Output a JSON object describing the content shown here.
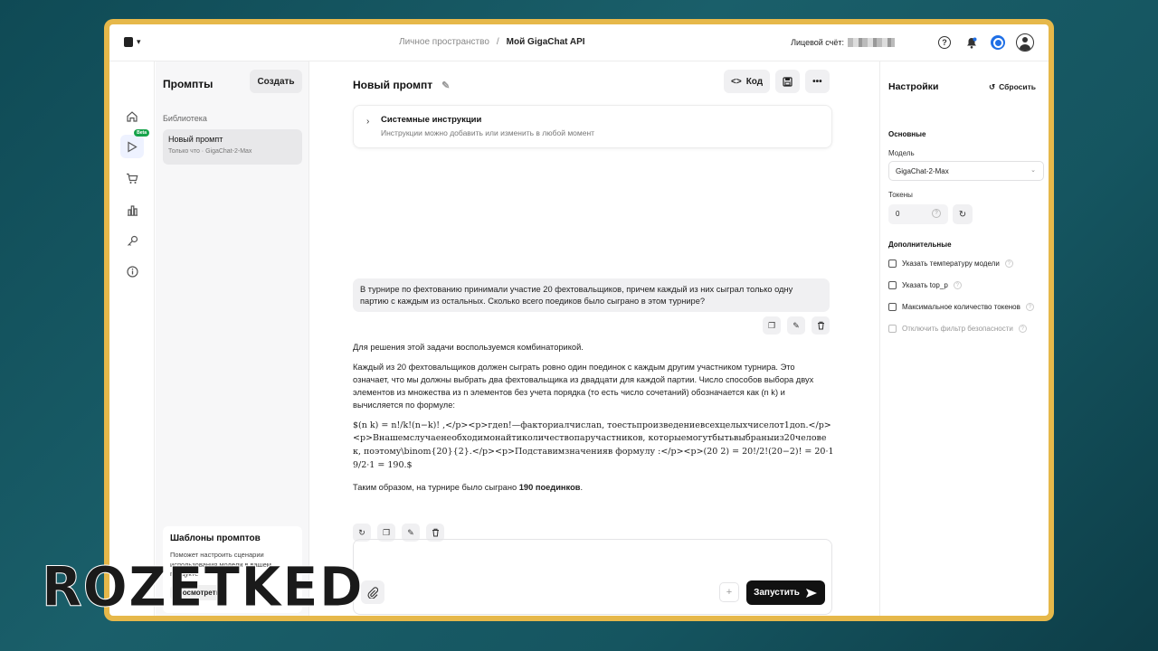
{
  "topbar": {
    "crumb_parent": "Личное пространство",
    "crumb_sep": "/",
    "crumb_current": "Мой GigaChat API",
    "account_label": "Лицевой счёт:"
  },
  "rail": {
    "beta": "Beta"
  },
  "prompts": {
    "title": "Промпты",
    "create": "Создать",
    "library": "Библиотека",
    "item_title": "Новый промпт",
    "item_sub": "Только что · GigaChat-2-Max",
    "templates_title": "Шаблоны промптов",
    "templates_desc": "Поможет настроить сценарии использования модели в вашем продукте",
    "templates_btn": "Посмотреть"
  },
  "main": {
    "title": "Новый промпт",
    "code_btn": "Код",
    "sys_title": "Системные инструкции",
    "sys_desc": "Инструкции можно добавить или изменить в любой момент",
    "user_msg": "В турнире по фехтованию принимали участие 20 фехтовальщиков, причем каждый из них сыграл только одну партию с каждым из остальных. Сколько всего поедиков было сыграно в этом турнире?",
    "ans_p1": "Для решения этой задачи воспользуемся комбинаторикой.",
    "ans_p2": "Каждый из 20 фехтовальщиков должен сыграть ровно один поединок с каждым другим участником турнира. Это означает, что мы должны выбрать два фехтовальщика из двадцати для каждой партии. Число способов выбора двух элементов из множества из n элементов без учета порядка (то есть число сочетаний) обозначается как (n k) и вычисляется по формуле:",
    "ans_math": "$(n k) = n!/k!(n−k)! ,</p><p>гдеn!—факториалчислаn, тоестьпроизведениевсехцелыхчиселот1доn.</p><p>Внашемслучаенеобходимонайтиколичествопаручастников, которыемогутбытьвыбраныиз20человек, поэтому\\binom{20}{2}.</p><p>Подставимзначенияв формулу :</p><p>(20 2) = 20!/2!(20−2)! = 20·19/2·1 = 190.$",
    "ans_p3_pre": "Таким образом, на турнире было сыграно ",
    "ans_p3_bold": "190 поединков",
    "ans_p3_post": ".",
    "run": "Запустить"
  },
  "settings": {
    "title": "Настройки",
    "reset": "Сбросить",
    "basic": "Основные",
    "model_label": "Модель",
    "model_value": "GigaChat-2-Max",
    "tokens_label": "Токены",
    "tokens_value": "0",
    "extra": "Дополнительные",
    "opt_temp": "Указать температуру модели",
    "opt_topp": "Указать top_p",
    "opt_max": "Максимальное количество токенов",
    "opt_filter": "Отключить фильтр безопасности"
  },
  "watermark": "ROZETKED",
  "colors": {
    "frame": "#e6b84a",
    "run_bg": "#111111",
    "accent": "#1f6fe6",
    "beta": "#16a34a"
  }
}
